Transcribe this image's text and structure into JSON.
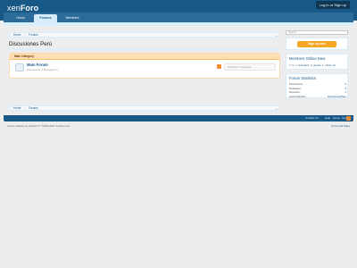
{
  "header": {
    "logo_part1": "xen",
    "logo_part2": "Foro",
    "login_label": "Log in or Sign up"
  },
  "nav": {
    "tabs": [
      {
        "label": "Home"
      },
      {
        "label": "Forums"
      },
      {
        "label": "Members"
      }
    ]
  },
  "breadcrumb": {
    "items": [
      "Home",
      "Forums"
    ]
  },
  "page": {
    "title": "Discusiones Perú"
  },
  "category": {
    "title": "Main Category",
    "forum": {
      "title": "Main Forum",
      "stats": "Discussions: 0   Messages: 0",
      "last_post": "Nothing to messages"
    }
  },
  "sidebar": {
    "search_placeholder": "Search...",
    "signup_label": "Sign up now!",
    "online": {
      "title": "Members Online Now",
      "text_prefix": "Total:",
      "text_rest": "1 (members: 0, guests: 1, robots: 0)"
    },
    "stats": {
      "title": "Forum Statistics",
      "rows": [
        {
          "label": "Discussions:",
          "value": "0"
        },
        {
          "label": "Messages:",
          "value": "0"
        },
        {
          "label": "Members:",
          "value": "1"
        },
        {
          "label": "Latest Member:",
          "value": "DiscusionesPeru"
        }
      ]
    }
  },
  "footer": {
    "links": [
      "Contact Us",
      "Help",
      "Home",
      "Top"
    ],
    "copyright": "Forum software by XenForo™ ©2010-2017 XenForo Ltd.",
    "terms": "Terms and Rules"
  },
  "colors": {
    "header": "#185886",
    "nav": "#2b6c9a",
    "accent_light": "#d7edfc",
    "category_head": "#fddfb3",
    "signup": "#f5a623",
    "rss": "#ee8a2f"
  }
}
